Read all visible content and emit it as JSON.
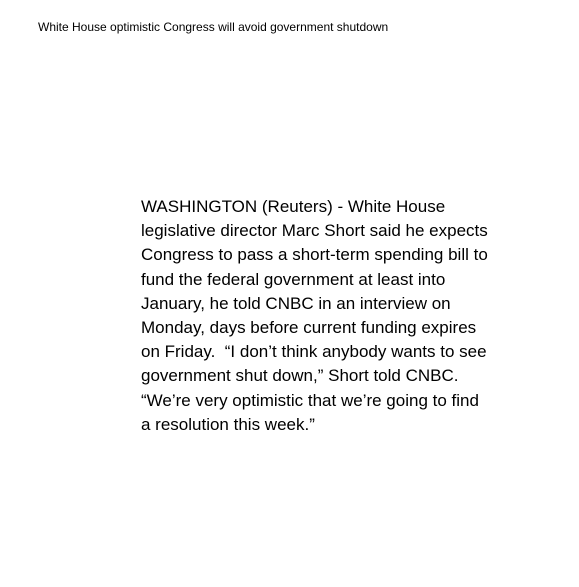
{
  "document": {
    "headline": "White House optimistic Congress will avoid government shutdown",
    "body_lines": [
      "WASHINGTON (Reuters) - White House",
      "legislative director Marc Short said he expects",
      "Congress to pass a short-term spending bill to",
      "fund the federal government at least into",
      "January, he told CNBC in an interview on",
      "Monday, days before current funding expires",
      "on Friday.  “I don’t think anybody wants to see",
      "government shut down,” Short told CNBC.",
      "“We’re very optimistic that we’re going to find",
      "a resolution this week.”"
    ]
  }
}
